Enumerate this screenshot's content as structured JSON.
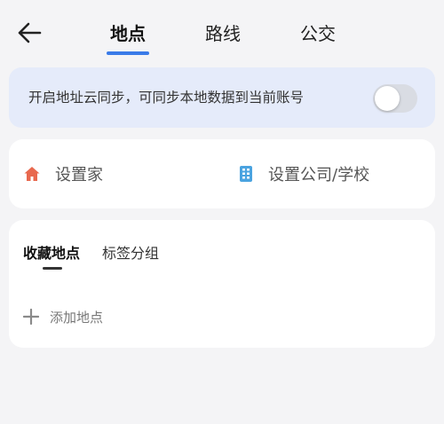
{
  "header": {
    "tabs": [
      {
        "label": "地点",
        "active": true
      },
      {
        "label": "路线",
        "active": false
      },
      {
        "label": "公交",
        "active": false
      }
    ]
  },
  "sync": {
    "text": "开启地址云同步，可同步本地数据到当前账号",
    "enabled": false
  },
  "shortcuts": {
    "home": {
      "label": "设置家",
      "icon": "home-icon"
    },
    "work": {
      "label": "设置公司/学校",
      "icon": "building-icon"
    }
  },
  "favorites": {
    "tabs": [
      {
        "label": "收藏地点",
        "active": true
      },
      {
        "label": "标签分组",
        "active": false
      }
    ],
    "add_label": "添加地点"
  },
  "colors": {
    "accent": "#3a7be8",
    "home_icon": "#e8684e",
    "building_icon": "#4aa3e0",
    "sync_bg": "#e5ebfa"
  }
}
